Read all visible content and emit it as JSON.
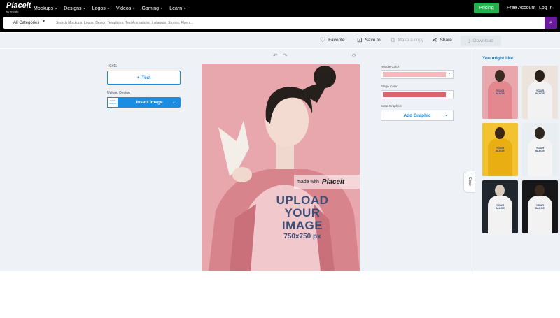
{
  "header": {
    "logo": "Placeit",
    "logo_sub": "by envato",
    "nav": [
      {
        "label": "Mockups"
      },
      {
        "label": "Designs"
      },
      {
        "label": "Logos"
      },
      {
        "label": "Videos"
      },
      {
        "label": "Gaming"
      },
      {
        "label": "Learn"
      }
    ],
    "pricing": "Pricing",
    "free_account": "Free Account",
    "login": "Log In"
  },
  "search": {
    "category": "All Categories",
    "placeholder": "Search Mockups, Logos, Design Templates, Text Animations, Instagram Stories, Flyers..."
  },
  "toolbar": {
    "favorite": "Favorite",
    "save": "Save to",
    "copy": "Make a copy",
    "share": "Share",
    "download": "Download"
  },
  "left_panel": {
    "texts_label": "Texts",
    "text_button": "Text",
    "upload_label": "Upload Design",
    "thumb_text": "YOUR IMAGE",
    "insert_button": "Insert Image"
  },
  "canvas": {
    "watermark_prefix": "made with",
    "watermark_brand": "Placeit",
    "upload_lines": [
      "UPLOAD",
      "YOUR",
      "IMAGE"
    ],
    "dimensions": "750x750 px"
  },
  "right_panel": {
    "hoodie_label": "Hoodie Color",
    "hoodie_color": "#f5b8bd",
    "stage_label": "Stage Color",
    "stage_color": "#d9656e",
    "extra_label": "Extra Graphics",
    "add_graphic": "Add Graphic"
  },
  "sidebar": {
    "title": "You might like",
    "close": "Close",
    "thumbs": [
      {
        "bg": "#e8a7ac",
        "body": "#e3888f",
        "skin": "#3a2a22",
        "print": "YOUR IMAGE"
      },
      {
        "bg": "#ece3dc",
        "body": "#f2f2f2",
        "skin": "#2b1f18",
        "print": "YOUR IMAGE"
      },
      {
        "bg": "#f2c230",
        "body": "#e8ae12",
        "skin": "#3d2618",
        "print": "YOUR IMAGE"
      },
      {
        "bg": "#e9eef3",
        "body": "#f4f4f4",
        "skin": "#2f2620",
        "print": "YOUR IMAGE"
      },
      {
        "bg": "#1f262e",
        "body": "#f2f2f2",
        "skin": "#d8c9bb",
        "print": "YOUR IMAGE"
      },
      {
        "bg": "#17171a",
        "body": "#f2f2f2",
        "skin": "#3a2a1f",
        "print": "YOUR IMAGE"
      }
    ]
  }
}
